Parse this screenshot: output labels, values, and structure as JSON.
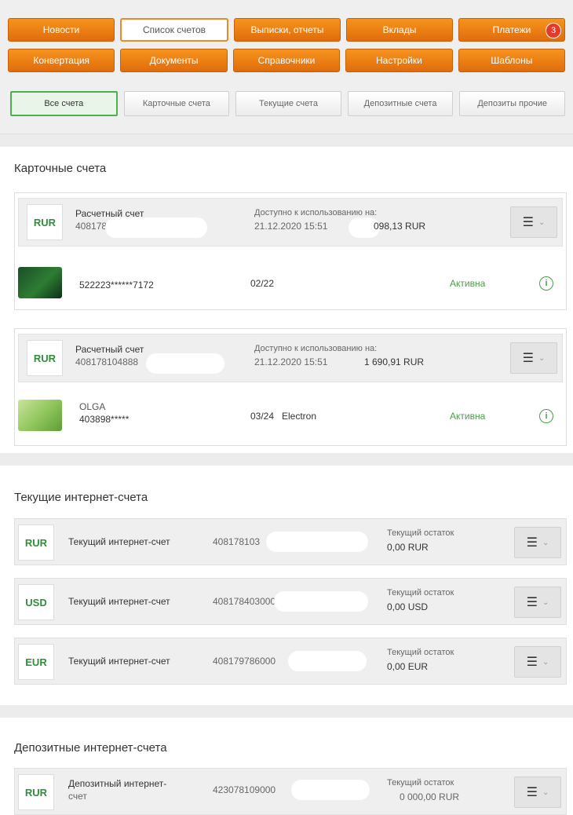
{
  "topnav": {
    "row1": [
      {
        "label": "Новости",
        "active": false
      },
      {
        "label": "Список счетов",
        "active": true
      },
      {
        "label": "Выписки, отчеты",
        "active": false
      },
      {
        "label": "Вклады",
        "active": false
      },
      {
        "label": "Платежи",
        "active": false,
        "badge": "3"
      }
    ],
    "row2": [
      {
        "label": "Конвертация"
      },
      {
        "label": "Документы"
      },
      {
        "label": "Справочники"
      },
      {
        "label": "Настройки"
      },
      {
        "label": "Шаблоны"
      }
    ],
    "filters": [
      {
        "label": "Все счета",
        "active": true
      },
      {
        "label": "Карточные счета",
        "active": false
      },
      {
        "label": "Текущие счета",
        "active": false
      },
      {
        "label": "Депозитные счета",
        "active": false
      },
      {
        "label": "Депозиты прочие",
        "active": false
      }
    ]
  },
  "card_section": {
    "title": "Карточные счета",
    "accounts": [
      {
        "currency": "RUR",
        "title": "Расчетный счет",
        "number": "408178",
        "available_label": "Доступно к использованию на:",
        "available_date": "21.12.2020 15:51",
        "available_amount": "098,13 RUR",
        "card": {
          "holder": "",
          "pan": "522223******7172",
          "exp": "02/22",
          "type": "",
          "status": "Активна"
        }
      },
      {
        "currency": "RUR",
        "title": "Расчетный счет",
        "number": "408178104888",
        "available_label": "Доступно к использованию на:",
        "available_date": "21.12.2020 15:51",
        "available_amount": "1 690,91 RUR",
        "card": {
          "holder": "OLGA",
          "pan": "403898*****",
          "exp": "03/24",
          "type": "Electron",
          "status": "Активна"
        }
      }
    ]
  },
  "current_section": {
    "title": "Текущие интернет-счета",
    "rows": [
      {
        "currency": "RUR",
        "name": "Текущий интернет-счет",
        "number": "408178103",
        "balance_label": "Текущий остаток",
        "balance": "0,00 RUR"
      },
      {
        "currency": "USD",
        "name": "Текущий интернет-счет",
        "number": "408178403000",
        "balance_label": "Текущий остаток",
        "balance": "0,00 USD"
      },
      {
        "currency": "EUR",
        "name": "Текущий интернет-счет",
        "number": "408179786000",
        "balance_label": "Текущий остаток",
        "balance": "0,00 EUR"
      }
    ]
  },
  "deposit_section": {
    "title": "Депозитные интернет-счета",
    "rows": [
      {
        "currency": "RUR",
        "name_line1": "Депозитный интернет-",
        "name_line2": "счет",
        "number": "423078109000",
        "balance_label": "Текущий остаток",
        "balance": "0 000,00 RUR"
      }
    ]
  },
  "colors": {
    "accent_orange": "#f7941d",
    "green": "#2f8f3a",
    "status_green": "#4a9e4a"
  },
  "icons": {
    "menu": "hamburger-icon",
    "dropdown": "chevron-down-icon",
    "info": "info-icon",
    "notifications": "notification-badge"
  }
}
